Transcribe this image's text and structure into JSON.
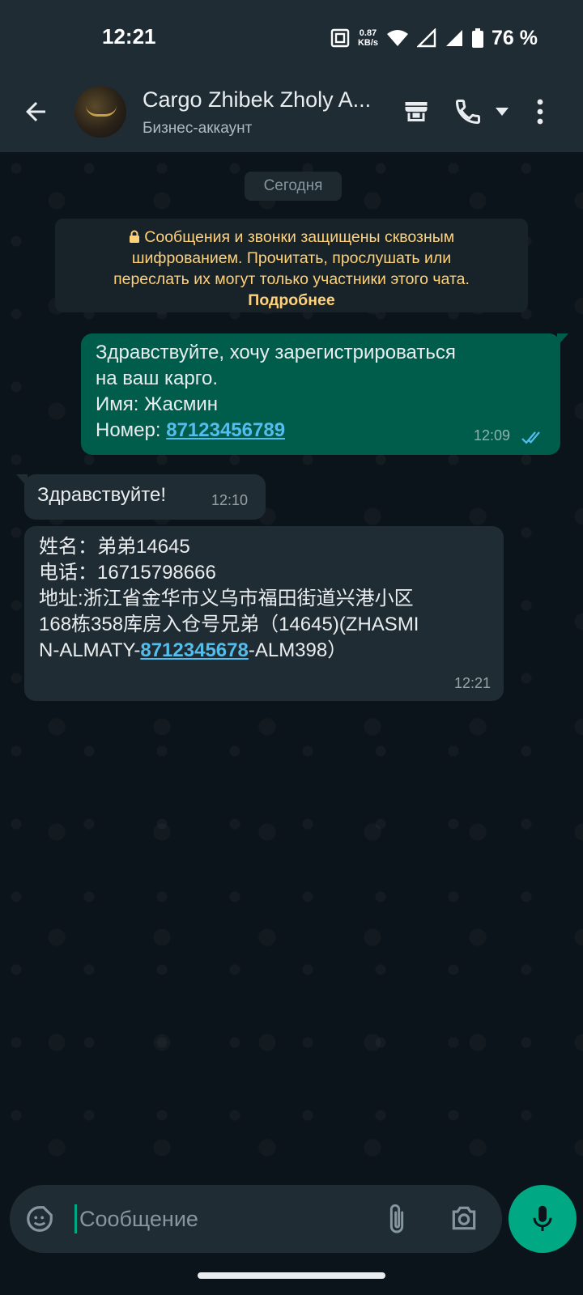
{
  "status_bar": {
    "time": "12:21",
    "net_speed_value": "0.87",
    "net_speed_unit": "KB/s",
    "battery": "76 %"
  },
  "header": {
    "contact_name": "Cargo Zhibek Zholy A...",
    "subtitle": "Бизнес-аккаунт",
    "icons": [
      "back-arrow-icon",
      "storefront-icon",
      "phone-icon",
      "dropdown-caret-icon",
      "more-vert-icon"
    ]
  },
  "chat": {
    "date_chip": "Сегодня",
    "encryption_notice": {
      "line1": "Сообщения и звонки защищены сквозным",
      "line2": "шифрованием. Прочитать, прослушать или",
      "line3": "переслать их могут только участники этого чата.",
      "more": "Подробнее"
    },
    "messages": [
      {
        "direction": "outgoing",
        "line1": "Здравствуйте, хочу зарегистрироваться",
        "line2": "на ваш карго.",
        "line3": "Имя: Жасмин",
        "line4_prefix": "Номер: ",
        "line4_link": "87123456789",
        "time": "12:09",
        "status": "read"
      },
      {
        "direction": "incoming",
        "text": "Здравствуйте!",
        "time": "12:10"
      },
      {
        "direction": "incoming",
        "line1": "姓名：弟弟14645",
        "line2": "电话：16715798666",
        "line3": "地址:浙江省金华市义乌市福田街道兴港小区",
        "line4": "168栋358库房入仓号兄弟（14645)(ZHASMI",
        "line5_prefix": "N-ALMATY-",
        "line5_link": "8712345678",
        "line5_suffix": "-ALM398）",
        "time": "12:21"
      }
    ]
  },
  "composer": {
    "placeholder": "Сообщение"
  },
  "colors": {
    "accent": "#00a884",
    "outgoing_bubble": "#005c4b",
    "incoming_bubble": "#202c33",
    "link": "#53bdeb",
    "notice_text": "#ffd279"
  }
}
